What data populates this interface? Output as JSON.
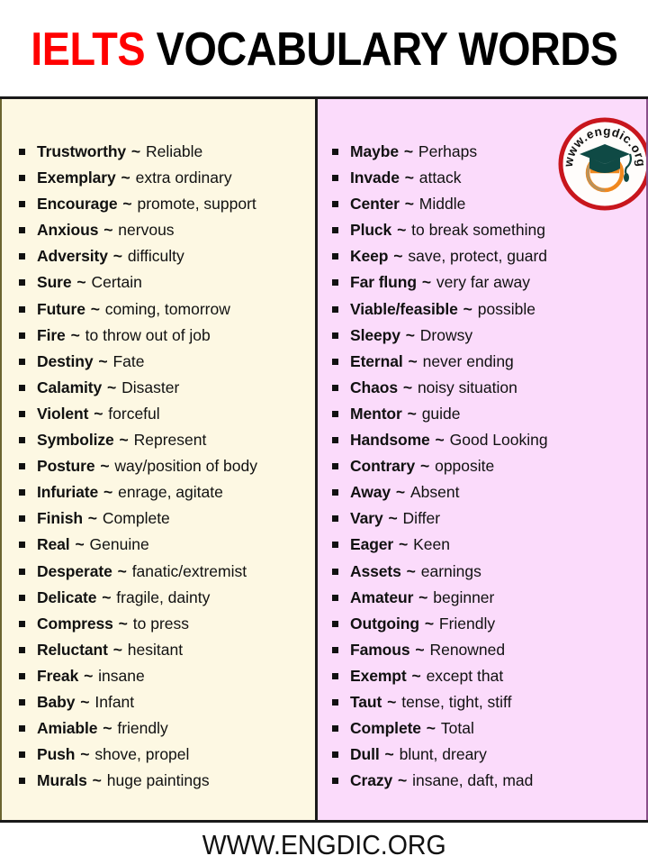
{
  "header": {
    "title_highlight": "IELTS",
    "title_rest": " VOCABULARY WORDS",
    "highlight_color": "#ff0000",
    "text_color": "#000000"
  },
  "colors": {
    "left_column_bg": "#fdf8e3",
    "right_column_bg": "#fbdbfb",
    "border": "#1a1a1a",
    "logo_ring": "#c8161d",
    "logo_cap": "#0f4a45",
    "logo_e": "#f0881f"
  },
  "logo": {
    "name": "engdic-logo",
    "curved_text": "www.engdic.org",
    "letter": "e"
  },
  "separator": "~",
  "columns": [
    {
      "id": "left-column",
      "items": [
        {
          "word": "Trustworthy",
          "meaning": "Reliable"
        },
        {
          "word": "Exemplary",
          "meaning": "extra ordinary"
        },
        {
          "word": "Encourage",
          "meaning": "promote, support"
        },
        {
          "word": "Anxious",
          "meaning": "nervous"
        },
        {
          "word": "Adversity",
          "meaning": "difficulty"
        },
        {
          "word": "Sure",
          "meaning": "Certain"
        },
        {
          "word": "Future",
          "meaning": "coming, tomorrow"
        },
        {
          "word": "Fire",
          "meaning": "to throw out of job"
        },
        {
          "word": "Destiny",
          "meaning": "Fate"
        },
        {
          "word": "Calamity",
          "meaning": "Disaster"
        },
        {
          "word": "Violent",
          "meaning": "forceful"
        },
        {
          "word": "Symbolize",
          "meaning": "Represent"
        },
        {
          "word": "Posture",
          "meaning": "way/position of body"
        },
        {
          "word": "Infuriate",
          "meaning": "enrage, agitate"
        },
        {
          "word": "Finish",
          "meaning": "Complete"
        },
        {
          "word": "Real",
          "meaning": "Genuine"
        },
        {
          "word": "Desperate",
          "meaning": "fanatic/extremist"
        },
        {
          "word": "Delicate",
          "meaning": "fragile, dainty"
        },
        {
          "word": "Compress",
          "meaning": "to press"
        },
        {
          "word": "Reluctant",
          "meaning": "hesitant"
        },
        {
          "word": "Freak",
          "meaning": "insane"
        },
        {
          "word": "Baby",
          "meaning": "Infant"
        },
        {
          "word": "Amiable",
          "meaning": "friendly"
        },
        {
          "word": "Push",
          "meaning": "shove, propel"
        },
        {
          "word": "Murals",
          "meaning": "huge paintings"
        }
      ]
    },
    {
      "id": "right-column",
      "items": [
        {
          "word": "Maybe",
          "meaning": "Perhaps"
        },
        {
          "word": "Invade",
          "meaning": "attack"
        },
        {
          "word": "Center",
          "meaning": "Middle"
        },
        {
          "word": "Pluck",
          "meaning": "to break something"
        },
        {
          "word": "Keep",
          "meaning": "save, protect, guard"
        },
        {
          "word": "Far flung",
          "meaning": "very far away"
        },
        {
          "word": "Viable/feasible",
          "meaning": "possible"
        },
        {
          "word": "Sleepy",
          "meaning": "Drowsy"
        },
        {
          "word": "Eternal",
          "meaning": "never ending"
        },
        {
          "word": "Chaos",
          "meaning": "noisy situation"
        },
        {
          "word": "Mentor",
          "meaning": "guide"
        },
        {
          "word": "Handsome",
          "meaning": "Good Looking"
        },
        {
          "word": "Contrary",
          "meaning": "opposite"
        },
        {
          "word": "Away",
          "meaning": "Absent"
        },
        {
          "word": "Vary",
          "meaning": "Differ"
        },
        {
          "word": "Eager",
          "meaning": "Keen"
        },
        {
          "word": "Assets",
          "meaning": "earnings"
        },
        {
          "word": "Amateur",
          "meaning": "beginner"
        },
        {
          "word": "Outgoing",
          "meaning": "Friendly"
        },
        {
          "word": "Famous",
          "meaning": "Renowned"
        },
        {
          "word": "Exempt",
          "meaning": "except that"
        },
        {
          "word": "Taut",
          "meaning": "tense, tight, stiff"
        },
        {
          "word": "Complete",
          "meaning": "Total"
        },
        {
          "word": "Dull",
          "meaning": "blunt, dreary"
        },
        {
          "word": "Crazy",
          "meaning": "insane, daft, mad"
        }
      ]
    }
  ],
  "footer": {
    "text": "WWW.ENGDIC.ORG"
  }
}
